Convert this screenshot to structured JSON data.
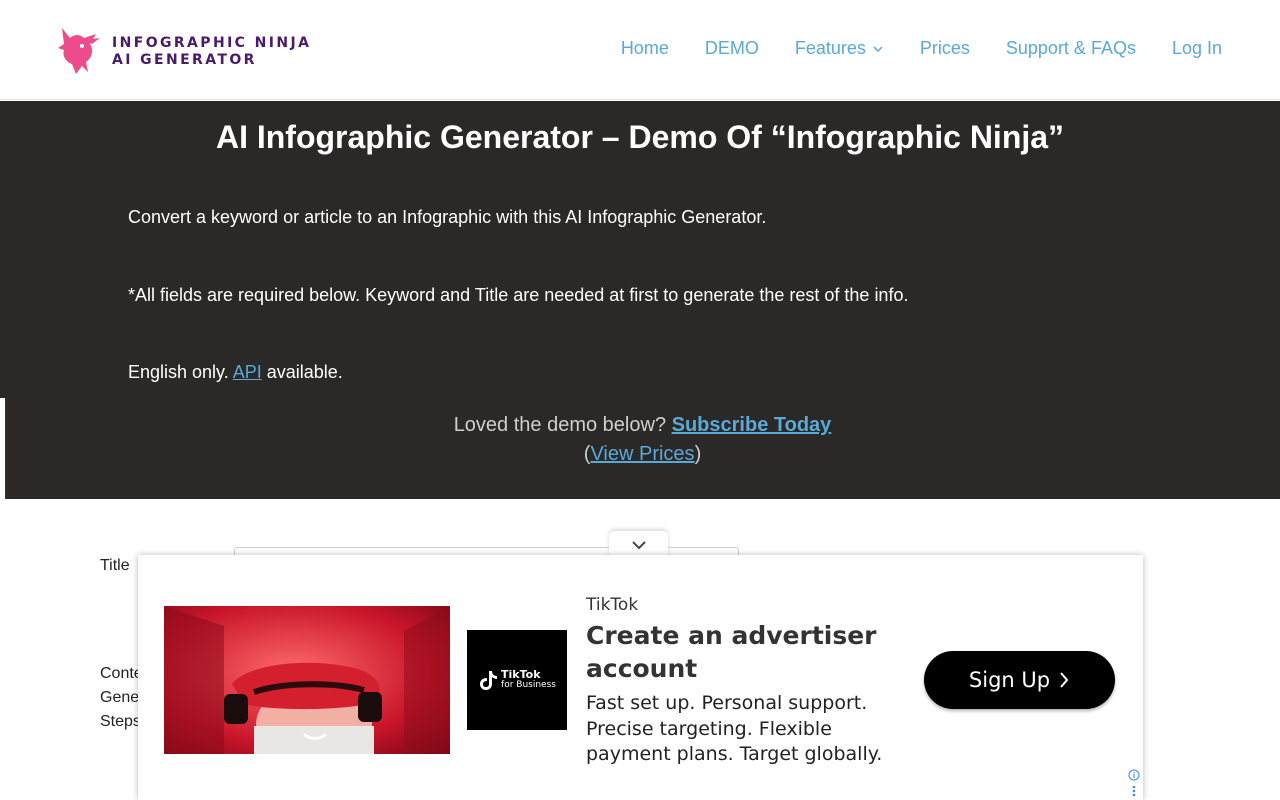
{
  "header": {
    "logo_line1": "INFOGRAPHIC NINJA",
    "logo_line2": "AI GENERATOR",
    "nav": {
      "home": "Home",
      "demo": "DEMO",
      "features": "Features",
      "prices": "Prices",
      "support": "Support & FAQs",
      "login": "Log In"
    }
  },
  "hero": {
    "title": "AI Infographic Generator – Demo Of “Infographic Ninja”",
    "p1": "Convert a keyword or article to an Infographic with this AI Infographic Generator.",
    "p2": "*All fields are required below. Keyword and Title are needed at first to generate the rest of the info.",
    "p3_before": "English only. ",
    "p3_link": "API",
    "p3_after": " available.",
    "promo_text": "Loved the demo below? ",
    "promo_link": "Subscribe Today",
    "prices_open": "(",
    "prices_link": "View Prices",
    "prices_close": ")"
  },
  "form": {
    "title_label": "Title",
    "content_label_1": "Conte",
    "content_label_2": "Gene",
    "content_label_3": "Steps"
  },
  "ad": {
    "brand": "TikTok",
    "headline": "Create an advertiser account",
    "description": "Fast set up. Personal support. Precise targeting. Flexible payment plans. Target globally.",
    "logo_line1": "TikTok",
    "logo_line2": "for Business",
    "cta": "Sign Up"
  },
  "colors": {
    "link": "#5aa9d6",
    "hero_bg": "#2b2828",
    "logo_text": "#4a1a6b",
    "logo_mark": "#ec4c8c"
  }
}
